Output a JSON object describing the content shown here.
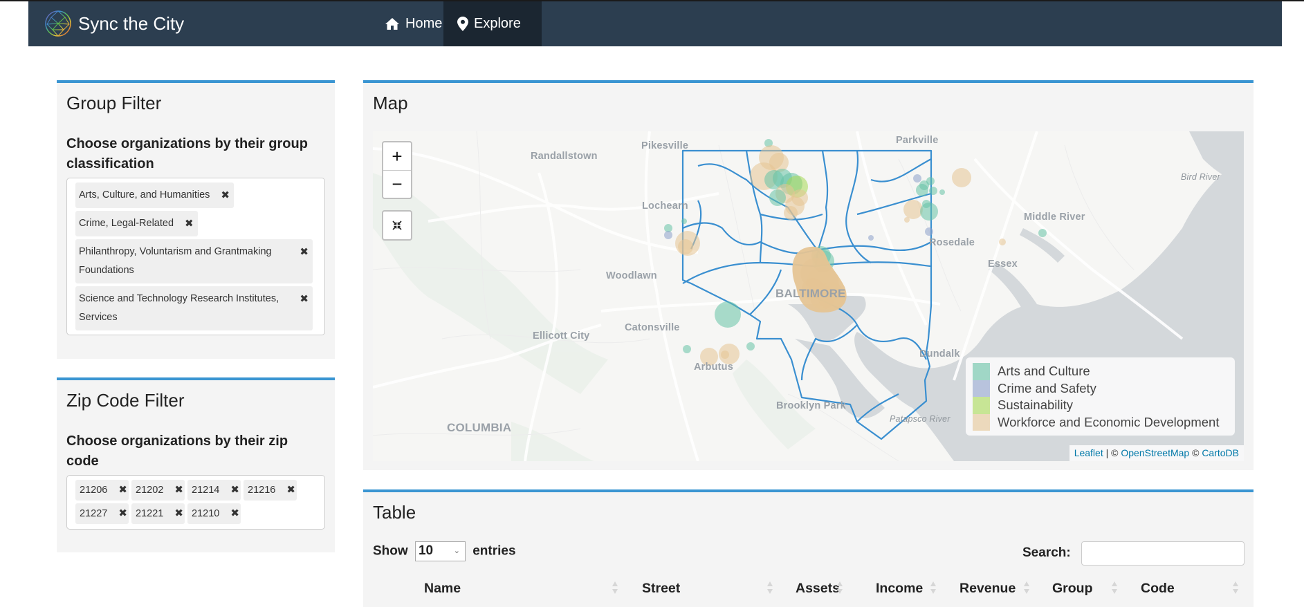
{
  "app": {
    "title": "Sync the City",
    "nav": [
      {
        "label": "Home",
        "icon": "home-icon",
        "active": false
      },
      {
        "label": "Explore",
        "icon": "map-marker-icon",
        "active": true
      }
    ]
  },
  "group_filter": {
    "title": "Group Filter",
    "label": "Choose organizations by their group classification",
    "selected": [
      "Arts, Culture, and Humanities",
      "Crime, Legal-Related",
      "Philanthropy, Voluntarism and Grantmaking Foundations",
      "Science and Technology Research Institutes, Services"
    ]
  },
  "zip_filter": {
    "title": "Zip Code Filter",
    "label": "Choose organizations by their zip code",
    "selected": [
      "21206",
      "21202",
      "21214",
      "21216",
      "21227",
      "21221",
      "21210"
    ]
  },
  "map": {
    "title": "Map",
    "zoom_in_label": "+",
    "zoom_out_label": "−",
    "reset_icon": "collapse-arrows-icon",
    "places": [
      {
        "name": "Randallstown",
        "type": "town"
      },
      {
        "name": "Pikesville",
        "type": "town"
      },
      {
        "name": "Parkville",
        "type": "town"
      },
      {
        "name": "Lochearn",
        "type": "town"
      },
      {
        "name": "Woodlawn",
        "type": "town"
      },
      {
        "name": "BALTIMORE",
        "type": "city"
      },
      {
        "name": "Catonsville",
        "type": "town"
      },
      {
        "name": "Ellicott City",
        "type": "town"
      },
      {
        "name": "Arbutus",
        "type": "town"
      },
      {
        "name": "Brooklyn Park",
        "type": "town"
      },
      {
        "name": "COLUMBIA",
        "type": "city"
      },
      {
        "name": "Middle River",
        "type": "town"
      },
      {
        "name": "Rosedale",
        "type": "town"
      },
      {
        "name": "Essex",
        "type": "town"
      },
      {
        "name": "Dundalk",
        "type": "town"
      },
      {
        "name": "Bird River",
        "type": "water"
      },
      {
        "name": "Patapsco River",
        "type": "water"
      }
    ],
    "legend": [
      {
        "label": "Arts and Culture",
        "color": "#66c2a5"
      },
      {
        "label": "Crime and Safety",
        "color": "#8da0cb"
      },
      {
        "label": "Sustainability",
        "color": "#a6d854"
      },
      {
        "label": "Workforce and Economic Development",
        "color": "#e5c494"
      }
    ],
    "attribution": {
      "leaflet": "Leaflet",
      "sep": " | © ",
      "osm": "OpenStreetMap",
      "copy": " © ",
      "carto": "CartoDB"
    }
  },
  "table": {
    "title": "Table",
    "show_label": "Show",
    "page_size": "10",
    "entries_label": "entries",
    "search_label": "Search:",
    "search_value": "",
    "columns": [
      "Name",
      "Street",
      "Assets",
      "Income",
      "Revenue",
      "Group",
      "Code"
    ]
  },
  "colors": {
    "navbar": "#2c3e50",
    "nav_active": "#1b2631",
    "accent": "#3a95d2",
    "boundary": "#3a8fd0"
  }
}
